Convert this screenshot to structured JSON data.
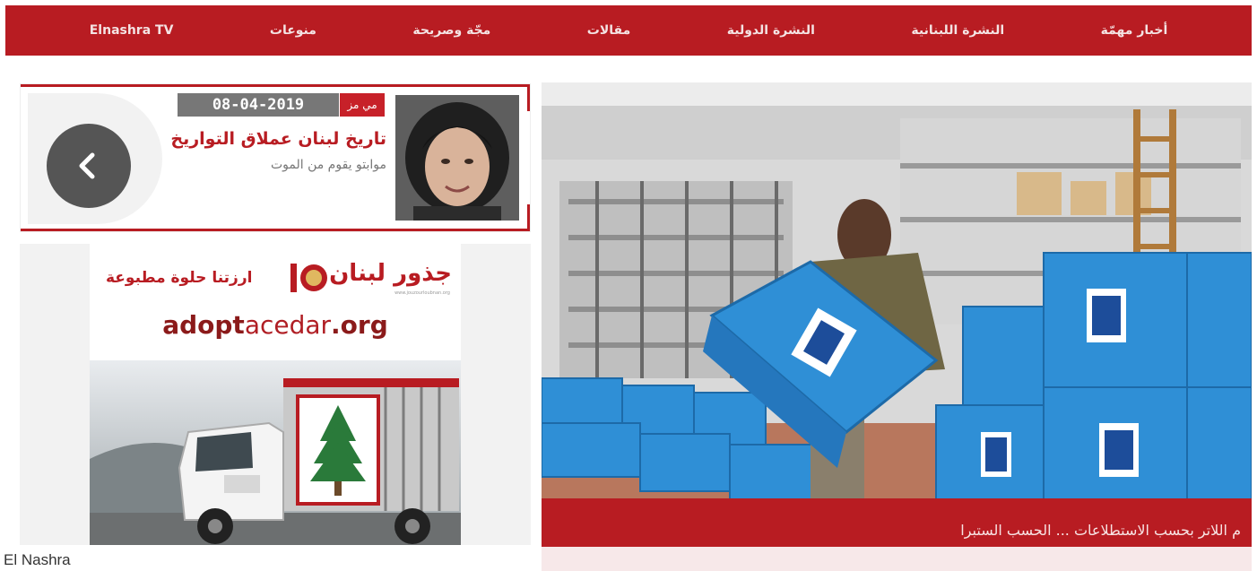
{
  "nav": {
    "items": [
      {
        "label": "أخبار مهمّة"
      },
      {
        "label": "النشرة اللبنانية"
      },
      {
        "label": "النشرة الدولية"
      },
      {
        "label": "مقالات"
      },
      {
        "label": "مجّة وصريحة"
      },
      {
        "label": "منوعات"
      },
      {
        "label": "Elnashra TV"
      }
    ]
  },
  "featured": {
    "author_badge": "مي مز",
    "date": "08-04-2019",
    "headline": "تاريخ لبنان عملاق التواريخ",
    "subline": "موابتو يقوم من الموت"
  },
  "ad": {
    "brand": "جذور لبنان",
    "slogan": "ارزتنا حلوة مطبوعة",
    "small_print": "www.jouzourloubnan.org",
    "url_a": "adopt",
    "url_b": "acedar",
    "url_c": ".org"
  },
  "main_story": {
    "caption": "م اللاتر بحسب الاستطلاعات ... الحسب الستبرا"
  },
  "footer": {
    "source": "El Nashra"
  },
  "colors": {
    "brand_red": "#b81c22",
    "box_blue": "#2f8fd6",
    "gray": "#777777"
  },
  "icons": {
    "arrow": "chevron-left-icon"
  }
}
